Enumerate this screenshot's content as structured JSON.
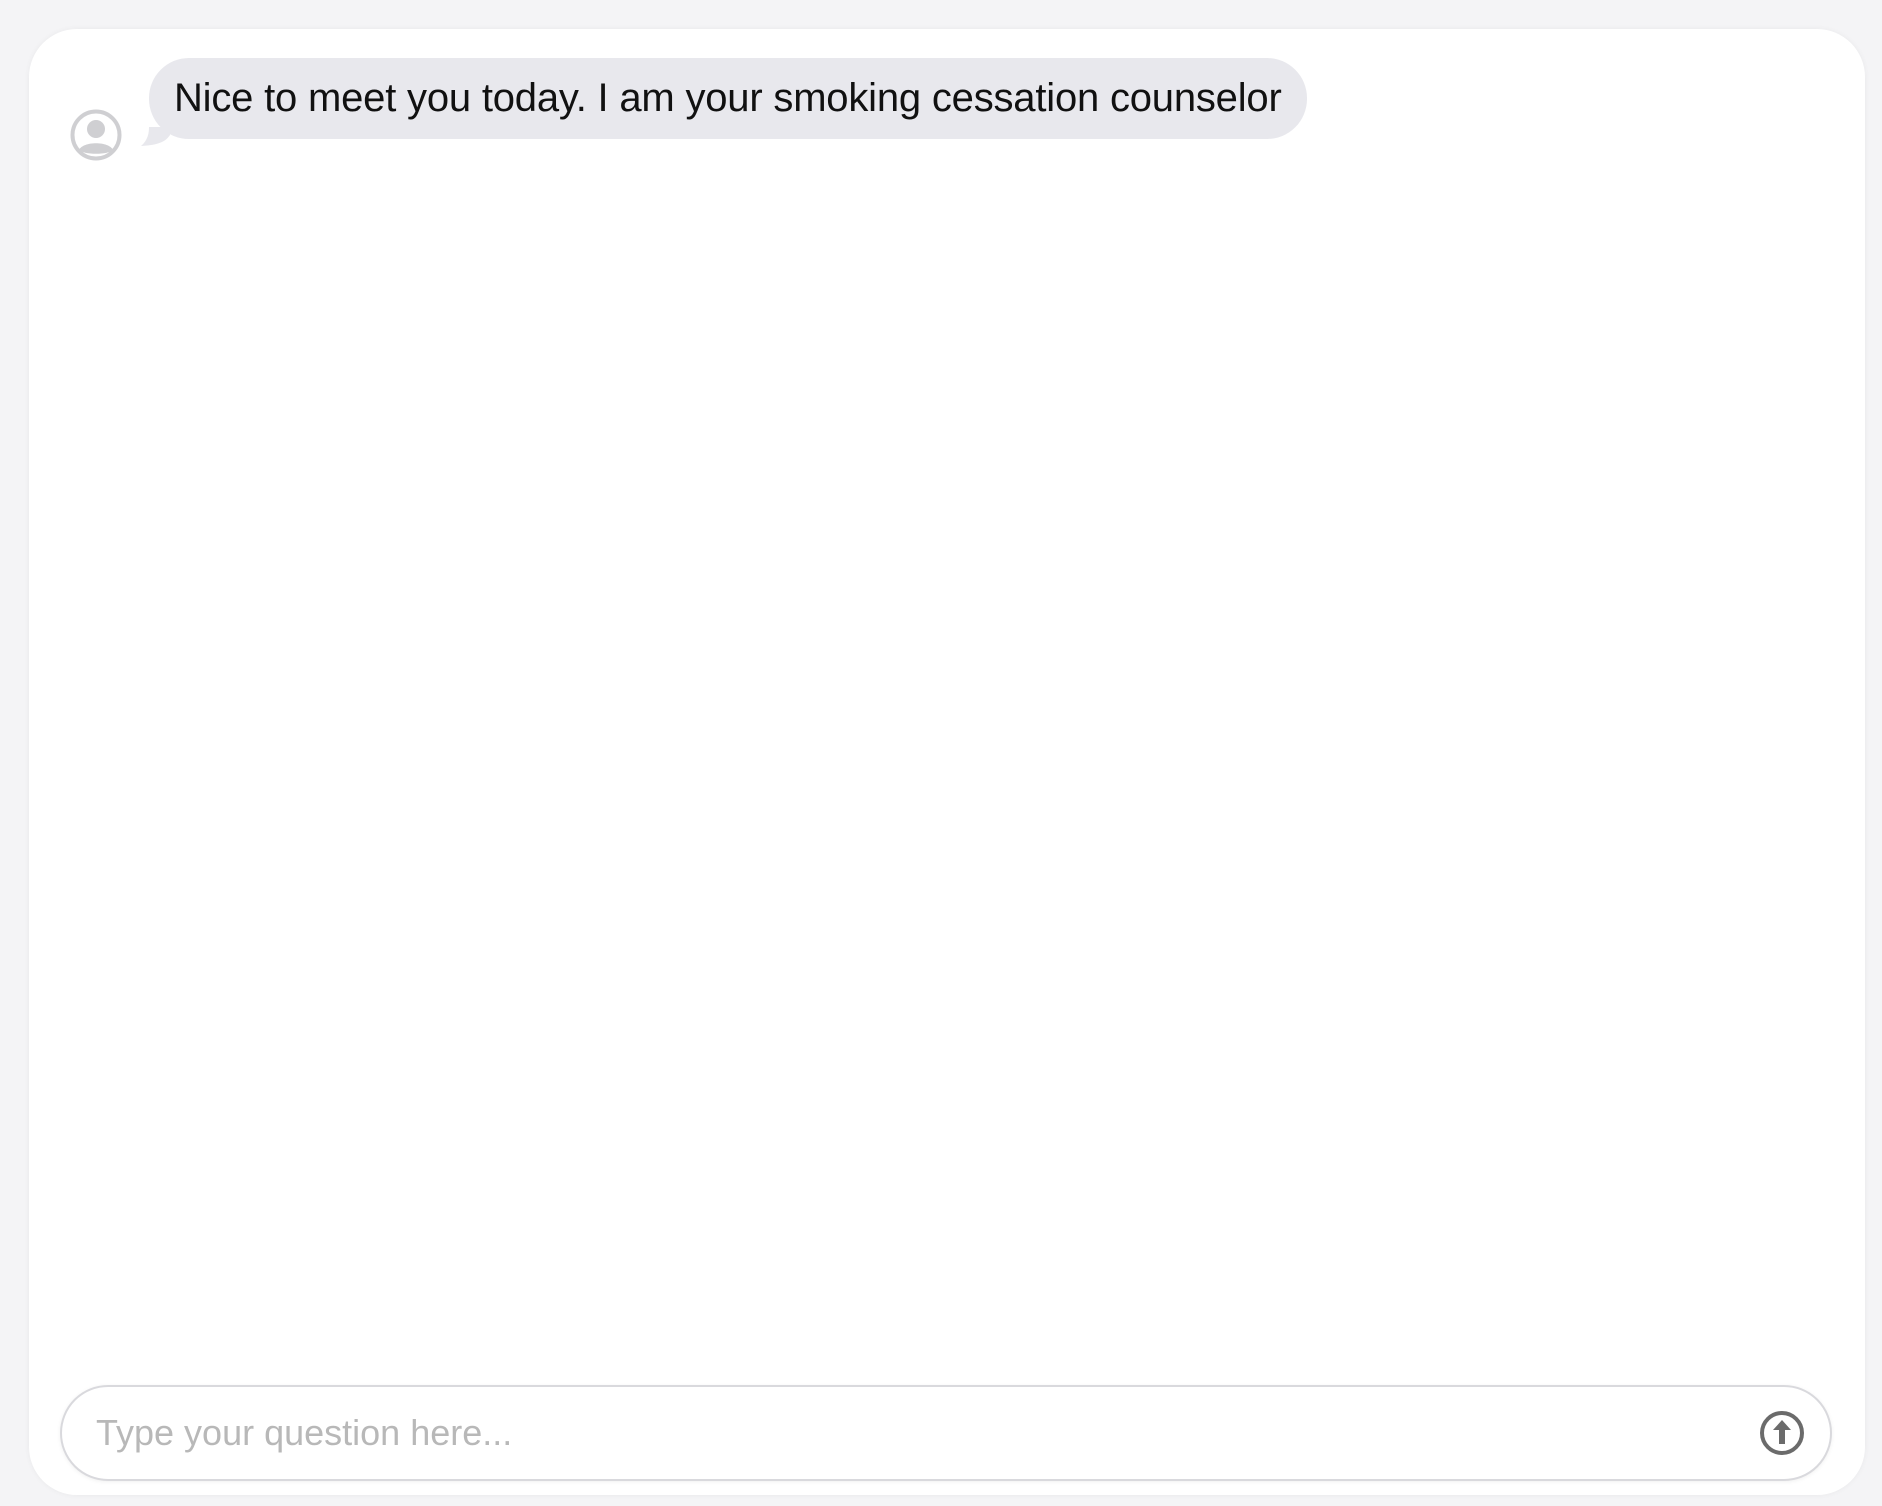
{
  "conversation": {
    "messages": [
      {
        "sender": "counselor",
        "avatar_icon": "user-avatar-icon",
        "text": "Nice to meet you today. I am your smoking cessation counselor"
      }
    ]
  },
  "composer": {
    "placeholder": "Type your question here...",
    "value": "",
    "send_icon": "arrow-up-circle-icon"
  },
  "colors": {
    "bubble_background": "#e8e8ed",
    "avatar_gray": "#cfcfd2",
    "send_icon": "#6b6b6b",
    "placeholder": "#b8b8b8"
  }
}
